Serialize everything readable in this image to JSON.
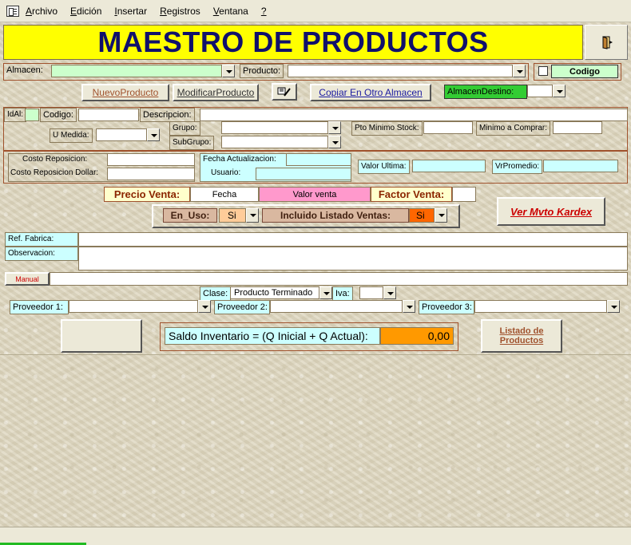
{
  "menu": {
    "items": [
      "Archivo",
      "Edición",
      "Insertar",
      "Registros",
      "Ventana",
      "?"
    ],
    "underline": [
      "A",
      "E",
      "I",
      "R",
      "V",
      "?"
    ]
  },
  "title": "MAESTRO DE PRODUCTOS",
  "exit_icon": "exit-door-icon",
  "top": {
    "almacen_label": "Almacen:",
    "producto_label": "Producto:",
    "codigo_label": "Codigo",
    "nuevo_prefix": "Nuevo",
    "nuevo_suffix": "Producto",
    "modificar_prefix": "Modificar",
    "modificar_suffix": "Producto",
    "copiar_label": "Copiar En Otro Almacen",
    "almacen_destino_label": "AlmacenDestino:"
  },
  "ident": {
    "idal_label": "IdAl:",
    "codigo_label": "Codigo:",
    "descripcion_label": "Descripcion:",
    "umedida_label": "U Medida:",
    "grupo_label": "Grupo:",
    "subgrupo_label": "SubGrupo:",
    "pto_minimo_label": "Pto Minimo Stock:",
    "minimo_comprar_label": "Minimo a Comprar:"
  },
  "costos": {
    "costo_reposicion_label": "Costo Reposicion:",
    "costo_dollar_label": "Costo Reposicion Dollar:",
    "fecha_act_label": "Fecha Actualizacion:",
    "usuario_label": "Usuario:",
    "valor_ultima_label": "Valor Ultima:",
    "vr_promedio_label": "VrPromedio:"
  },
  "precio": {
    "precio_venta_label": "Precio Venta:",
    "fecha_label": "Fecha",
    "valor_venta_label": "Valor venta",
    "factor_venta_label": "Factor Venta:",
    "en_uso_label": "En_Uso:",
    "en_uso_value": "Si",
    "incluido_label": "Incluido Listado Ventas:",
    "incluido_value": "Si",
    "kardex_label": "Ver Mvto Kardex"
  },
  "obs": {
    "ref_fabrica_label": "Ref. Fabrica:",
    "observacion_label": "Observacion:",
    "manual_label": "Manual"
  },
  "clase": {
    "clase_label": "Clase:",
    "clase_value": "Producto Terminado",
    "iva_label": "Iva:"
  },
  "proveedores": [
    "Proveedor 1:",
    "Proveedor 2:",
    "Proveedor 3:"
  ],
  "saldo": {
    "label": "Saldo Inventario = (Q Inicial + Q Actual):",
    "value": "0,00"
  },
  "listado_label_1": "Listado de",
  "listado_label_2": "Productos",
  "colors": {
    "title_bg": "#ffff00",
    "title_text": "#10106b",
    "field_cyan": "#ccffff",
    "pink": "#ff99cc",
    "orange": "#ff9900",
    "green": "#33cc33",
    "light_green": "#ccffcc",
    "red_link": "#cc0000"
  }
}
